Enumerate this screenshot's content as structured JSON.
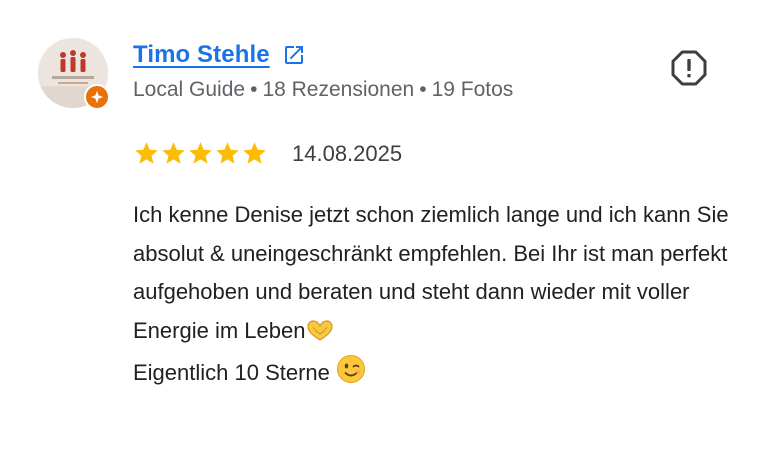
{
  "reviewer": {
    "name": "Timo Stehle",
    "meta": {
      "badge": "Local Guide",
      "separator": "•",
      "reviews": "18 Rezensionen",
      "photos": "19 Fotos"
    },
    "avatar_logo_text": "ZAHNARZTPRAXIS AM MARKTPLATZ",
    "avatar_icon": "practice-logo-icon",
    "badge_icon": "local-guide-star-icon"
  },
  "icons": {
    "external_link": "external-link-icon",
    "report": "report-icon",
    "star": "star-icon"
  },
  "review": {
    "rating": 5,
    "max_rating": 5,
    "date": "14.08.2025",
    "lines": [
      "Ich kenne Denise jetzt schon ziemlich lange und ich kann Sie absolut & uneingeschränkt empfehlen. Bei Ihr ist man perfekt aufgehoben und beraten und steht dann wieder mit voller Energie im Leben",
      "Eigentlich 10 Sterne"
    ],
    "emojis": [
      "heart-hands-emoji",
      "winking-face-emoji"
    ]
  },
  "colors": {
    "link": "#1a73e8",
    "star": "#fbbc04",
    "meta_text": "#5f6368",
    "badge": "#e8710a"
  }
}
